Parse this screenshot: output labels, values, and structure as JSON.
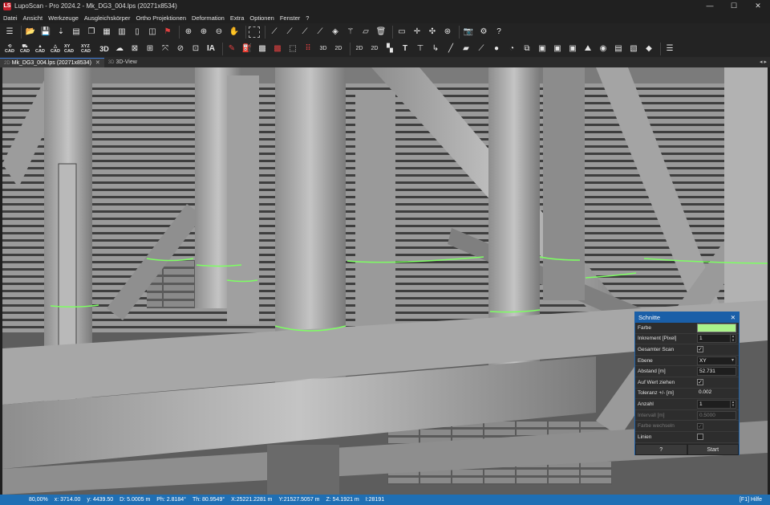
{
  "window": {
    "title": "LupoScan - Pro 2024.2 - Mk_DG3_004.lps (20271x8534)",
    "app_icon": "LS",
    "controls": [
      "—",
      "☐",
      "✕"
    ]
  },
  "menu": [
    "Datei",
    "Ansicht",
    "Werkzeuge",
    "Ausgleichskörper",
    "Ortho Projektionen",
    "Deformation",
    "Extra",
    "Optionen",
    "Fenster",
    "?"
  ],
  "toolbar1": {
    "icons": [
      "list-icon",
      "folder-open-icon",
      "save-icon",
      "import-icon",
      "scan-icon",
      "copy-icon",
      "grid-icon",
      "layout-icon",
      "columns-icon",
      "split-icon",
      "flag-icon",
      "zoom-plus-icon",
      "zoom-in-icon",
      "zoom-out-icon",
      "hand-icon",
      "select-rect-icon",
      "measure-icon",
      "measure2-icon",
      "measure3-icon",
      "fill-icon",
      "wand-icon",
      "eraser-icon",
      "trash-icon",
      "ruler-icon",
      "crosshair-icon",
      "cross-icon",
      "target-icon",
      "camera-icon",
      "gear-icon",
      "help-icon"
    ]
  },
  "toolbar2": {
    "labels": [
      "CAD",
      "CAD",
      "CAD",
      "CAD",
      "XY CAD",
      "XYZ CAD",
      "3D"
    ],
    "icon_label_ia": "IA",
    "icon_label_t": "T"
  },
  "tabs": [
    {
      "prefix": "2D",
      "label": "Mk_DG3_004.lps (20271x8534)",
      "active": true,
      "close": "✕"
    },
    {
      "prefix": "3D",
      "label": "3D-View",
      "active": false
    }
  ],
  "tab_nav": "◂ ▸",
  "panel": {
    "title": "Schnitte",
    "close": "✕",
    "fields": [
      {
        "label": "Farbe",
        "type": "color",
        "value": "#aaf38a"
      },
      {
        "label": "Inkrement [Pixel]",
        "type": "spin",
        "value": "1"
      },
      {
        "label": "Gesamter Scan",
        "type": "check",
        "checked": true
      },
      {
        "label": "Ebene",
        "type": "select",
        "value": "XY"
      },
      {
        "label": "Abstand [m]",
        "type": "text",
        "value": "52.731"
      },
      {
        "label": "Auf Wert ziehen",
        "type": "check",
        "checked": true
      },
      {
        "label": "Toleranz +/- [m]",
        "type": "text",
        "value": "0.002"
      },
      {
        "label": "Anzahl",
        "type": "spin",
        "value": "1"
      },
      {
        "label": "Intervall [m]",
        "type": "text",
        "value": "0.5000",
        "disabled": true
      },
      {
        "label": "Farbe wechseln",
        "type": "check",
        "checked": true,
        "disabled": true
      },
      {
        "label": "Linien",
        "type": "check",
        "checked": false
      }
    ],
    "help_button": "?",
    "start_button": "Start"
  },
  "status": {
    "zoom": "80,00%",
    "x": "x:   3714.00",
    "y": "y:   4439.50",
    "d": "D:  5.0005 m",
    "ph": "Ph:   2.8184°",
    "th": "Th:  80.9549°",
    "X": "X:25221.2281 m",
    "Y": "Y:21527.5057 m",
    "Z": "Z:  54.1921 m",
    "I": "I:28191",
    "help": "[F1] Hilfe"
  }
}
